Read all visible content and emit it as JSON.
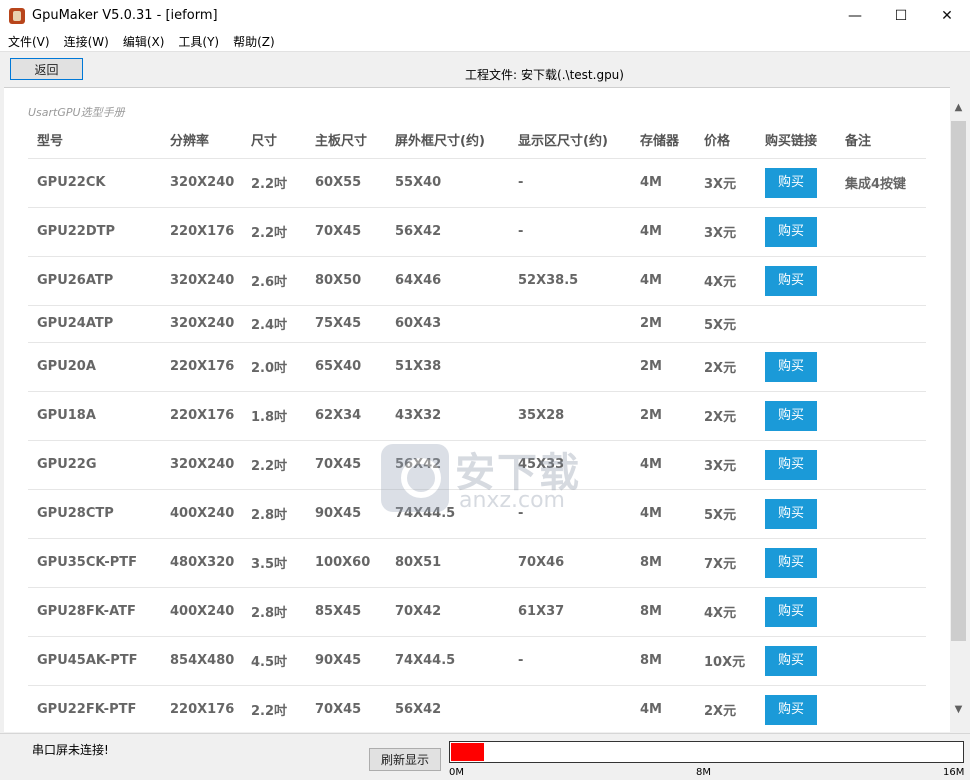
{
  "window": {
    "title": "GpuMaker V5.0.31 - [ieform]",
    "controls": {
      "minimize": "—",
      "maximize": "☐",
      "close": "✕"
    }
  },
  "menu": [
    "文件(V)",
    "连接(W)",
    "编辑(X)",
    "工具(Y)",
    "帮助(Z)"
  ],
  "toolbar": {
    "back_label": "返回",
    "project_label": "工程文件:",
    "project_value": "安下载(.\\test.gpu)"
  },
  "catalog": {
    "title": "UsartGPU选型手册",
    "headers": [
      "型号",
      "分辨率",
      "尺寸",
      "主板尺寸",
      "屏外框尺寸(约)",
      "显示区尺寸(约)",
      "存储器",
      "价格",
      "购买链接",
      "备注"
    ],
    "buy_label": "购买",
    "rows": [
      {
        "model": "GPU22CK",
        "resolution": "320X240",
        "size": "2.2吋",
        "board": "60X55",
        "outer": "55X40",
        "display": "-",
        "memory": "4M",
        "price": "3X元",
        "buy": true,
        "note": "集成4按键"
      },
      {
        "model": "GPU22DTP",
        "resolution": "220X176",
        "size": "2.2吋",
        "board": "70X45",
        "outer": "56X42",
        "display": "-",
        "memory": "4M",
        "price": "3X元",
        "buy": true,
        "note": ""
      },
      {
        "model": "GPU26ATP",
        "resolution": "320X240",
        "size": "2.6吋",
        "board": "80X50",
        "outer": "64X46",
        "display": "52X38.5",
        "memory": "4M",
        "price": "4X元",
        "buy": true,
        "note": ""
      },
      {
        "model": "GPU24ATP",
        "resolution": "320X240",
        "size": "2.4吋",
        "board": "75X45",
        "outer": "60X43",
        "display": "",
        "memory": "2M",
        "price": "5X元",
        "buy": false,
        "note": ""
      },
      {
        "model": "GPU20A",
        "resolution": "220X176",
        "size": "2.0吋",
        "board": "65X40",
        "outer": "51X38",
        "display": "",
        "memory": "2M",
        "price": "2X元",
        "buy": true,
        "note": ""
      },
      {
        "model": "GPU18A",
        "resolution": "220X176",
        "size": "1.8吋",
        "board": "62X34",
        "outer": "43X32",
        "display": "35X28",
        "memory": "2M",
        "price": "2X元",
        "buy": true,
        "note": ""
      },
      {
        "model": "GPU22G",
        "resolution": "320X240",
        "size": "2.2吋",
        "board": "70X45",
        "outer": "56X42",
        "display": "45X33",
        "memory": "4M",
        "price": "3X元",
        "buy": true,
        "note": ""
      },
      {
        "model": "GPU28CTP",
        "resolution": "400X240",
        "size": "2.8吋",
        "board": "90X45",
        "outer": "74X44.5",
        "display": "-",
        "memory": "4M",
        "price": "5X元",
        "buy": true,
        "note": ""
      },
      {
        "model": "GPU35CK-PTF",
        "resolution": "480X320",
        "size": "3.5吋",
        "board": "100X60",
        "outer": "80X51",
        "display": "70X46",
        "memory": "8M",
        "price": "7X元",
        "buy": true,
        "note": ""
      },
      {
        "model": "GPU28FK-ATF",
        "resolution": "400X240",
        "size": "2.8吋",
        "board": "85X45",
        "outer": "70X42",
        "display": "61X37",
        "memory": "8M",
        "price": "4X元",
        "buy": true,
        "note": ""
      },
      {
        "model": "GPU45AK-PTF",
        "resolution": "854X480",
        "size": "4.5吋",
        "board": "90X45",
        "outer": "74X44.5",
        "display": "-",
        "memory": "8M",
        "price": "10X元",
        "buy": true,
        "note": ""
      },
      {
        "model": "GPU22FK-PTF",
        "resolution": "220X176",
        "size": "2.2吋",
        "board": "70X45",
        "outer": "56X42",
        "display": "",
        "memory": "4M",
        "price": "2X元",
        "buy": true,
        "note": ""
      }
    ]
  },
  "status": {
    "message": "串口屏未连接!",
    "refresh_label": "刷新显示",
    "memory_labels": [
      "0M",
      "8M",
      "16M"
    ],
    "memory_used_fraction": 0.064,
    "memory_fill_color": "#ff0000"
  },
  "watermark": {
    "cn": "安下载",
    "en": "anxz.com"
  }
}
